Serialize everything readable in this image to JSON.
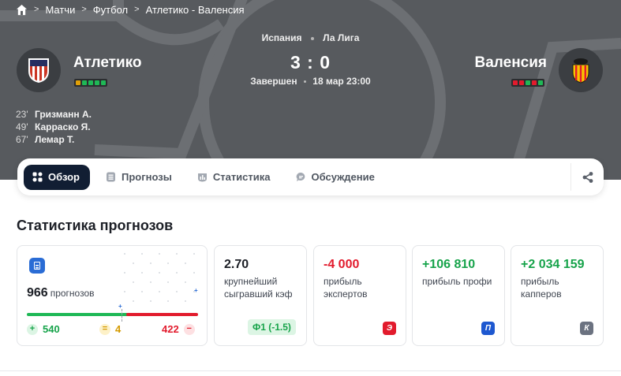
{
  "breadcrumb": {
    "home_icon": "home-icon",
    "items": [
      "Матчи",
      "Футбол",
      "Атлетико - Валенсия"
    ]
  },
  "match": {
    "country": "Испания",
    "league": "Ла Лига",
    "score": "3 : 0",
    "status": "Завершен",
    "datetime": "18 мар 23:00",
    "home": {
      "name": "Атлетико",
      "form": [
        "#e0a008",
        "#1fb856",
        "#1fb856",
        "#1fb856",
        "#1fb856"
      ]
    },
    "away": {
      "name": "Валенсия",
      "form": [
        "#e21b2d",
        "#e21b2d",
        "#1fb856",
        "#e21b2d",
        "#1fb856"
      ]
    },
    "goals": [
      {
        "minute": "23'",
        "player": "Гризманн А."
      },
      {
        "minute": "49'",
        "player": "Карраско Я."
      },
      {
        "minute": "67'",
        "player": "Лемар Т."
      }
    ]
  },
  "tabs": [
    {
      "label": "Обзор",
      "icon": "overview-icon",
      "active": true
    },
    {
      "label": "Прогнозы",
      "icon": "forecast-icon",
      "active": false
    },
    {
      "label": "Статистика",
      "icon": "stats-icon",
      "active": false
    },
    {
      "label": "Обсуждение",
      "icon": "chat-icon",
      "active": false
    }
  ],
  "stats": {
    "title": "Статистика прогнозов",
    "forecasts": {
      "count": "966",
      "label": "прогнозов",
      "win": "540",
      "draw": "4",
      "loss": "422"
    },
    "cards": [
      {
        "value": "2.70",
        "label": "крупнейший сыгравший кэф",
        "tag": "Ф1 (-1.5)"
      },
      {
        "value": "-4 000",
        "label": "прибыль экспертов",
        "badge": "Э"
      },
      {
        "value": "+106 810",
        "label": "прибыль профи",
        "badge": "П"
      },
      {
        "value": "+2 034 159",
        "label": "прибыль капперов",
        "badge": "К"
      }
    ]
  },
  "colors": {
    "accent_dark": "#111e33",
    "win": "#1fb856",
    "loss": "#e21b2d",
    "draw": "#e0a008"
  }
}
